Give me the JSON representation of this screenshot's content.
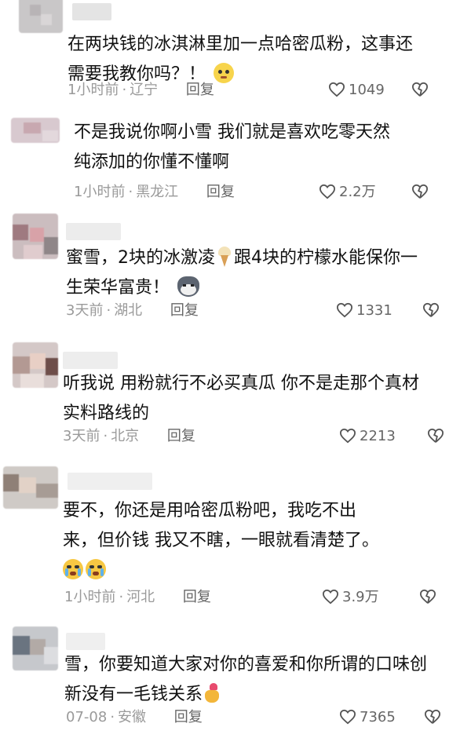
{
  "comments": [
    {
      "line1": "在两块钱的冰淇淋里加一点哈密瓜粉，这事还",
      "line2": "需要我教你吗？！",
      "time": "1小时前",
      "location": "辽宁",
      "reply": "回复",
      "likes": "1049"
    },
    {
      "line1": "不是我说你啊小雪 我们就是喜欢吃零天然",
      "line2": "纯添加的你懂不懂啊",
      "time": "1小时前",
      "location": "黑龙江",
      "reply": "回复",
      "likes": "2.2万"
    },
    {
      "line1a": "蜜雪，2块的冰激凌",
      "line1b": "跟4块的柠檬水能保你一",
      "line2": "生荣华富贵！",
      "time": "3天前",
      "location": "湖北",
      "reply": "回复",
      "likes": "1331"
    },
    {
      "line1": "听我说 用粉就行不必买真瓜 你不是走那个真材",
      "line2": "实料路线的",
      "time": "3天前",
      "location": "北京",
      "reply": "回复",
      "likes": "2213"
    },
    {
      "line1": "要不，你还是用哈密瓜粉吧，我吃不出",
      "line2": "来，但价钱 我又不瞎，一眼就看清楚了。",
      "time": "1小时前",
      "location": "河北",
      "reply": "回复",
      "likes": "3.9万"
    },
    {
      "line1": "雪，你要知道大家对你的喜爱和你所谓的口味创",
      "line2": "新没有一毛钱关系",
      "time": "07-08",
      "location": "安徽",
      "reply": "回复",
      "likes": "7365"
    }
  ],
  "colors": {
    "meta": "#9a9a9a",
    "text": "#111111",
    "icon": "#555555"
  }
}
